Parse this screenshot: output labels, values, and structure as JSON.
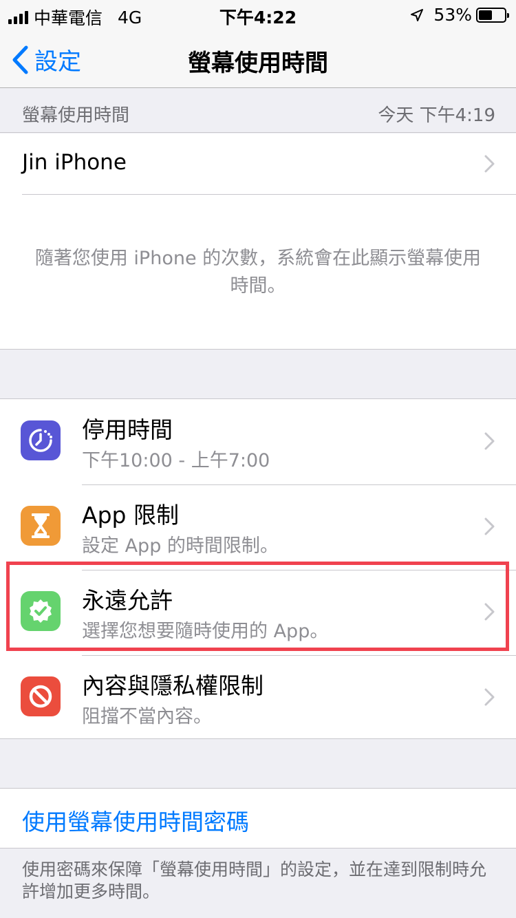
{
  "status_bar": {
    "carrier": "中華電信",
    "network": "4G",
    "time": "下午4:22",
    "battery": "53%",
    "battery_level": 0.53
  },
  "nav": {
    "back_label": "設定",
    "title": "螢幕使用時間"
  },
  "summary": {
    "header_left": "螢幕使用時間",
    "header_right": "今天 下午4:19",
    "device_name": "Jin iPhone",
    "description": "隨著您使用 iPhone 的次數，系統會在此顯示螢幕使用時間。"
  },
  "features": [
    {
      "title": "停用時間",
      "subtitle": "下午10:00 - 上午7:00",
      "icon": "downtime-icon",
      "color": "#5856d6"
    },
    {
      "title": "App 限制",
      "subtitle": "設定 App 的時間限制。",
      "icon": "hourglass-icon",
      "color": "#f09a37"
    },
    {
      "title": "永遠允許",
      "subtitle": "選擇您想要隨時使用的 App。",
      "icon": "checkmark-badge-icon",
      "color": "#65d36e"
    },
    {
      "title": "內容與隱私權限制",
      "subtitle": "阻擋不當內容。",
      "icon": "prohibited-icon",
      "color": "#eb4d3d"
    }
  ],
  "passcode": {
    "link": "使用螢幕使用時間密碼",
    "footer": "使用密碼來保障「螢幕使用時間」的設定，並在達到限制時允許增加更多時間。"
  },
  "colors": {
    "accent": "#007aff",
    "highlight": "#f0424f"
  }
}
